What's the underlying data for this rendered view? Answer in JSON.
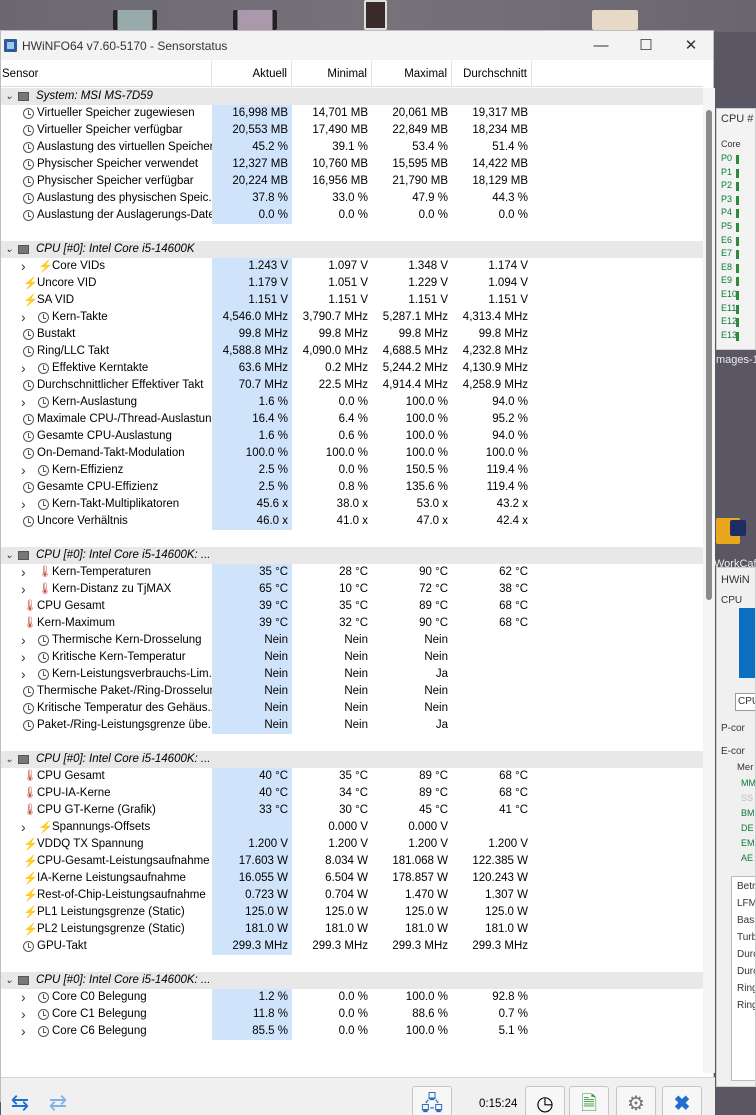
{
  "window": {
    "title": "HWiNFO64 v7.60-5170 - Sensorstatus",
    "minimize": "—",
    "maximize": "☐",
    "close": "✕"
  },
  "columns": {
    "sensor": "Sensor",
    "current": "Aktuell",
    "min": "Minimal",
    "max": "Maximal",
    "avg": "Durchschnitt"
  },
  "rows": [
    {
      "type": "group",
      "name": "System: MSI MS-7D59",
      "cur": "",
      "min": "",
      "max": "",
      "avg": ""
    },
    {
      "type": "item",
      "icon": "clock",
      "name": "Virtueller Speicher zugewiesen",
      "cur": "16,998 MB",
      "min": "14,701 MB",
      "max": "20,061 MB",
      "avg": "19,317 MB"
    },
    {
      "type": "item",
      "icon": "clock",
      "name": "Virtueller Speicher verfügbar",
      "cur": "20,553 MB",
      "min": "17,490 MB",
      "max": "22,849 MB",
      "avg": "18,234 MB"
    },
    {
      "type": "item",
      "icon": "clock",
      "name": "Auslastung des virtuellen Speichers",
      "cur": "45.2 %",
      "min": "39.1 %",
      "max": "53.4 %",
      "avg": "51.4 %"
    },
    {
      "type": "item",
      "icon": "clock",
      "name": "Physischer Speicher verwendet",
      "cur": "12,327 MB",
      "min": "10,760 MB",
      "max": "15,595 MB",
      "avg": "14,422 MB"
    },
    {
      "type": "item",
      "icon": "clock",
      "name": "Physischer Speicher verfügbar",
      "cur": "20,224 MB",
      "min": "16,956 MB",
      "max": "21,790 MB",
      "avg": "18,129 MB"
    },
    {
      "type": "item",
      "icon": "clock",
      "name": "Auslastung des physischen Speic...",
      "cur": "37.8 %",
      "min": "33.0 %",
      "max": "47.9 %",
      "avg": "44.3 %"
    },
    {
      "type": "item",
      "icon": "clock",
      "name": "Auslastung der Auslagerungs-Datei",
      "cur": "0.0 %",
      "min": "0.0 %",
      "max": "0.0 %",
      "avg": "0.0 %"
    },
    {
      "type": "blank"
    },
    {
      "type": "group",
      "name": "CPU [#0]: Intel Core i5-14600K",
      "cur": "",
      "min": "",
      "max": "",
      "avg": ""
    },
    {
      "type": "item",
      "expand": true,
      "icon": "bolt",
      "name": "Core VIDs",
      "cur": "1.243 V",
      "min": "1.097 V",
      "max": "1.348 V",
      "avg": "1.174 V"
    },
    {
      "type": "item",
      "icon": "bolt",
      "name": "Uncore VID",
      "cur": "1.179 V",
      "min": "1.051 V",
      "max": "1.229 V",
      "avg": "1.094 V"
    },
    {
      "type": "item",
      "icon": "bolt",
      "name": "SA VID",
      "cur": "1.151 V",
      "min": "1.151 V",
      "max": "1.151 V",
      "avg": "1.151 V"
    },
    {
      "type": "item",
      "expand": true,
      "icon": "clock",
      "name": "Kern-Takte",
      "cur": "4,546.0 MHz",
      "min": "3,790.7 MHz",
      "max": "5,287.1 MHz",
      "avg": "4,313.4 MHz"
    },
    {
      "type": "item",
      "icon": "clock",
      "name": "Bustakt",
      "cur": "99.8 MHz",
      "min": "99.8 MHz",
      "max": "99.8 MHz",
      "avg": "99.8 MHz"
    },
    {
      "type": "item",
      "icon": "clock",
      "name": "Ring/LLC Takt",
      "cur": "4,588.8 MHz",
      "min": "4,090.0 MHz",
      "max": "4,688.5 MHz",
      "avg": "4,232.8 MHz"
    },
    {
      "type": "item",
      "expand": true,
      "icon": "clock",
      "name": "Effektive Kerntakte",
      "cur": "63.6 MHz",
      "min": "0.2 MHz",
      "max": "5,244.2 MHz",
      "avg": "4,130.9 MHz"
    },
    {
      "type": "item",
      "icon": "clock",
      "name": "Durchschnittlicher Effektiver Takt",
      "cur": "70.7 MHz",
      "min": "22.5 MHz",
      "max": "4,914.4 MHz",
      "avg": "4,258.9 MHz"
    },
    {
      "type": "item",
      "expand": true,
      "icon": "clock",
      "name": "Kern-Auslastung",
      "cur": "1.6 %",
      "min": "0.0 %",
      "max": "100.0 %",
      "avg": "94.0 %"
    },
    {
      "type": "item",
      "icon": "clock",
      "name": "Maximale CPU-/Thread-Auslastung",
      "cur": "16.4 %",
      "min": "6.4 %",
      "max": "100.0 %",
      "avg": "95.2 %"
    },
    {
      "type": "item",
      "icon": "clock",
      "name": "Gesamte CPU-Auslastung",
      "cur": "1.6 %",
      "min": "0.6 %",
      "max": "100.0 %",
      "avg": "94.0 %"
    },
    {
      "type": "item",
      "icon": "clock",
      "name": "On-Demand-Takt-Modulation",
      "cur": "100.0 %",
      "min": "100.0 %",
      "max": "100.0 %",
      "avg": "100.0 %"
    },
    {
      "type": "item",
      "expand": true,
      "icon": "clock",
      "name": "Kern-Effizienz",
      "cur": "2.5 %",
      "min": "0.0 %",
      "max": "150.5 %",
      "avg": "119.4 %"
    },
    {
      "type": "item",
      "icon": "clock",
      "name": "Gesamte CPU-Effizienz",
      "cur": "2.5 %",
      "min": "0.8 %",
      "max": "135.6 %",
      "avg": "119.4 %"
    },
    {
      "type": "item",
      "expand": true,
      "icon": "clock",
      "name": "Kern-Takt-Multiplikatoren",
      "cur": "45.6 x",
      "min": "38.0 x",
      "max": "53.0 x",
      "avg": "43.2 x"
    },
    {
      "type": "item",
      "icon": "clock",
      "name": "Uncore Verhältnis",
      "cur": "46.0 x",
      "min": "41.0 x",
      "max": "47.0 x",
      "avg": "42.4 x"
    },
    {
      "type": "blank"
    },
    {
      "type": "group",
      "name": "CPU [#0]: Intel Core i5-14600K: ...",
      "cur": "",
      "min": "",
      "max": "",
      "avg": ""
    },
    {
      "type": "item",
      "expand": true,
      "icon": "therm",
      "name": "Kern-Temperaturen",
      "cur": "35 °C",
      "min": "28 °C",
      "max": "90 °C",
      "avg": "62 °C"
    },
    {
      "type": "item",
      "expand": true,
      "icon": "therm",
      "name": "Kern-Distanz zu TjMAX",
      "cur": "65 °C",
      "min": "10 °C",
      "max": "72 °C",
      "avg": "38 °C"
    },
    {
      "type": "item",
      "icon": "therm",
      "name": "CPU Gesamt",
      "cur": "39 °C",
      "min": "35 °C",
      "max": "89 °C",
      "avg": "68 °C"
    },
    {
      "type": "item",
      "icon": "therm",
      "name": "Kern-Maximum",
      "cur": "39 °C",
      "min": "32 °C",
      "max": "90 °C",
      "avg": "68 °C"
    },
    {
      "type": "item",
      "expand": true,
      "icon": "clock",
      "name": "Thermische Kern-Drosselung",
      "cur": "Nein",
      "min": "Nein",
      "max": "Nein",
      "avg": ""
    },
    {
      "type": "item",
      "expand": true,
      "icon": "clock",
      "name": "Kritische Kern-Temperatur",
      "cur": "Nein",
      "min": "Nein",
      "max": "Nein",
      "avg": ""
    },
    {
      "type": "item",
      "expand": true,
      "icon": "clock",
      "name": "Kern-Leistungsverbrauchs-Lim...",
      "cur": "Nein",
      "min": "Nein",
      "max": "Ja",
      "avg": ""
    },
    {
      "type": "item",
      "icon": "clock",
      "name": "Thermische Paket-/Ring-Drosselung",
      "cur": "Nein",
      "min": "Nein",
      "max": "Nein",
      "avg": ""
    },
    {
      "type": "item",
      "icon": "clock",
      "name": "Kritische Temperatur des Gehäus...",
      "cur": "Nein",
      "min": "Nein",
      "max": "Nein",
      "avg": ""
    },
    {
      "type": "item",
      "icon": "clock",
      "name": "Paket-/Ring-Leistungsgrenze übe...",
      "cur": "Nein",
      "min": "Nein",
      "max": "Ja",
      "avg": ""
    },
    {
      "type": "blank"
    },
    {
      "type": "group",
      "name": "CPU [#0]: Intel Core i5-14600K: ...",
      "cur": "",
      "min": "",
      "max": "",
      "avg": ""
    },
    {
      "type": "item",
      "icon": "therm",
      "name": "CPU Gesamt",
      "cur": "40 °C",
      "min": "35 °C",
      "max": "89 °C",
      "avg": "68 °C"
    },
    {
      "type": "item",
      "icon": "therm",
      "name": "CPU-IA-Kerne",
      "cur": "40 °C",
      "min": "34 °C",
      "max": "89 °C",
      "avg": "68 °C"
    },
    {
      "type": "item",
      "icon": "therm",
      "name": "CPU GT-Kerne (Grafik)",
      "cur": "33 °C",
      "min": "30 °C",
      "max": "45 °C",
      "avg": "41 °C"
    },
    {
      "type": "item",
      "expand": true,
      "icon": "bolt",
      "name": "Spannungs-Offsets",
      "cur": "",
      "min": "0.000 V",
      "max": "0.000 V",
      "avg": ""
    },
    {
      "type": "item",
      "icon": "bolt",
      "name": "VDDQ TX Spannung",
      "cur": "1.200 V",
      "min": "1.200 V",
      "max": "1.200 V",
      "avg": "1.200 V"
    },
    {
      "type": "item",
      "icon": "bolt",
      "name": "CPU-Gesamt-Leistungsaufnahme",
      "cur": "17.603 W",
      "min": "8.034 W",
      "max": "181.068 W",
      "avg": "122.385 W"
    },
    {
      "type": "item",
      "icon": "bolt",
      "name": "IA-Kerne Leistungsaufnahme",
      "cur": "16.055 W",
      "min": "6.504 W",
      "max": "178.857 W",
      "avg": "120.243 W"
    },
    {
      "type": "item",
      "icon": "bolt",
      "name": "Rest-of-Chip-Leistungsaufnahme",
      "cur": "0.723 W",
      "min": "0.704 W",
      "max": "1.470 W",
      "avg": "1.307 W"
    },
    {
      "type": "item",
      "icon": "bolt",
      "name": "PL1 Leistungsgrenze (Static)",
      "cur": "125.0 W",
      "min": "125.0 W",
      "max": "125.0 W",
      "avg": "125.0 W"
    },
    {
      "type": "item",
      "icon": "bolt",
      "name": "PL2 Leistungsgrenze (Static)",
      "cur": "181.0 W",
      "min": "181.0 W",
      "max": "181.0 W",
      "avg": "181.0 W"
    },
    {
      "type": "item",
      "icon": "clock",
      "name": "GPU-Takt",
      "cur": "299.3 MHz",
      "min": "299.3 MHz",
      "max": "299.3 MHz",
      "avg": "299.3 MHz"
    },
    {
      "type": "blank"
    },
    {
      "type": "group",
      "name": "CPU [#0]: Intel Core i5-14600K: ...",
      "cur": "",
      "min": "",
      "max": "",
      "avg": ""
    },
    {
      "type": "item",
      "expand": true,
      "icon": "clock",
      "name": "Core C0 Belegung",
      "cur": "1.2 %",
      "min": "0.0 %",
      "max": "100.0 %",
      "avg": "92.8 %"
    },
    {
      "type": "item",
      "expand": true,
      "icon": "clock",
      "name": "Core C1 Belegung",
      "cur": "11.8 %",
      "min": "0.0 %",
      "max": "88.6 %",
      "avg": "0.7 %"
    },
    {
      "type": "item",
      "expand": true,
      "icon": "clock",
      "name": "Core C6 Belegung",
      "cur": "85.5 %",
      "min": "0.0 %",
      "max": "100.0 %",
      "avg": "5.1 %"
    }
  ],
  "bottom": {
    "timer": "0:15:24"
  },
  "background": {
    "cpu_window_title": "CPU #",
    "cpu_window_col": "Core",
    "cores": [
      "P0",
      "P1",
      "P2",
      "P3",
      "P4",
      "P5",
      "E6",
      "E7",
      "E8",
      "E9",
      "E10",
      "E11",
      "E12",
      "E13"
    ],
    "images_label": "mages-1",
    "workcafe_label": "WorkCaf",
    "hwinfo_label": "HWiN",
    "cpu_label": "CPU",
    "cpu_field": "CPU",
    "pcore": "P-cor",
    "ecore": "E-cor",
    "mem": "Mer",
    "lines": [
      "MM",
      "SS",
      "BM",
      "DE",
      "EM",
      "AE"
    ],
    "list": [
      "Betr",
      "LFM",
      "Basi",
      "Turb",
      "Durc",
      "Durc",
      "Ring",
      "Ring"
    ]
  }
}
